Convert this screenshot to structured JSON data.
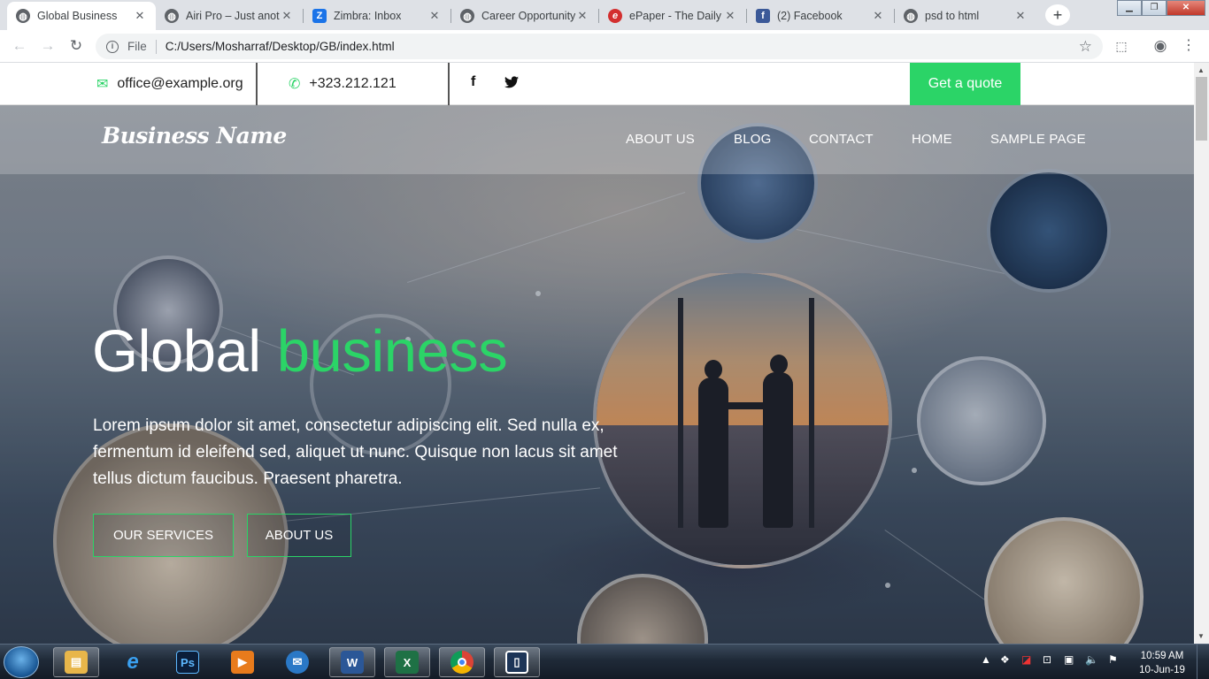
{
  "browser": {
    "tabs": [
      {
        "title": "Global Business",
        "favicon": "globe-icon",
        "active": true
      },
      {
        "title": "Airi Pro – Just anot",
        "favicon": "globe-icon"
      },
      {
        "title": "Zimbra: Inbox",
        "favicon": "zimbra-icon",
        "glyph": "Z"
      },
      {
        "title": "Career Opportunity",
        "favicon": "globe-icon"
      },
      {
        "title": "ePaper - The Daily",
        "favicon": "epaper-icon",
        "glyph": "e"
      },
      {
        "title": "(2) Facebook",
        "favicon": "facebook-icon",
        "glyph": "f"
      },
      {
        "title": "psd to html",
        "favicon": "globe-icon"
      }
    ],
    "address": {
      "protocol": "File",
      "url": "C:/Users/Mosharraf/Desktop/GB/index.html"
    }
  },
  "topbar": {
    "email": "office@example.org",
    "phone": "+323.212.121",
    "social": [
      {
        "icon": "facebook-icon",
        "glyph": "f"
      },
      {
        "icon": "twitter-icon",
        "glyph": "🐦"
      }
    ],
    "quote_label": "Get a quote"
  },
  "navbar": {
    "logo": "Business Name",
    "menu": [
      "ABOUT US",
      "BLOG",
      "CONTACT",
      "HOME",
      "SAMPLE PAGE"
    ]
  },
  "hero": {
    "title_main": "Global",
    "title_highlight": "business",
    "text": "Lorem ipsum dolor sit amet, consectetur adipiscing elit. Sed nulla ex, fermentum id eleifend sed, aliquet ut nunc. Quisque non lacus sit amet tellus dictum faucibus. Praesent pharetra.",
    "buttons": [
      "OUR SERVICES",
      "ABOUT US"
    ]
  },
  "colors": {
    "accent": "#2bd467",
    "white": "#ffffff"
  },
  "taskbar": {
    "apps": [
      "file-explorer-icon",
      "internet-explorer-icon",
      "photoshop-icon",
      "media-player-icon",
      "mail-icon",
      "word-icon",
      "excel-icon",
      "chrome-icon",
      "app-icon"
    ],
    "time": "10:59 AM",
    "date": "10-Jun-19"
  }
}
